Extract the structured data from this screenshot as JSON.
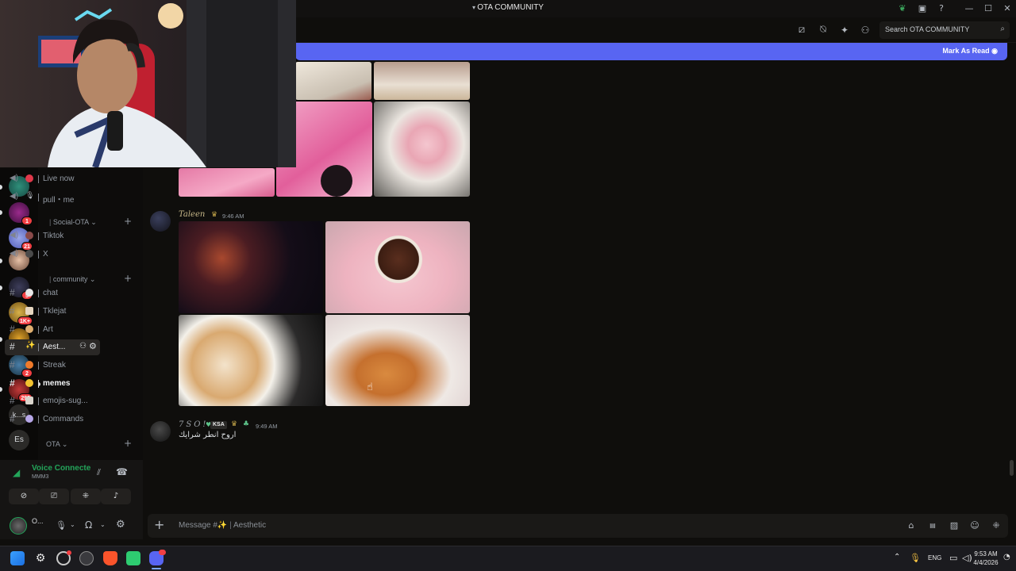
{
  "window": {
    "title": "OTA COMMUNITY"
  },
  "header": {
    "search_placeholder": "Search OTA COMMUNITY"
  },
  "new_messages_bar": {
    "mark_as_read": "Mark As Read"
  },
  "servers": [
    {
      "badge": ""
    },
    {
      "badge": "1"
    },
    {
      "badge": "21"
    },
    {
      "badge": ""
    },
    {
      "badge": "5"
    },
    {
      "badge": "1K+"
    },
    {
      "badge": "49"
    },
    {
      "badge": "2"
    },
    {
      "badge": "293"
    },
    {
      "label": "k...s"
    },
    {
      "label": "Es"
    }
  ],
  "channels": {
    "voice_top": [
      {
        "label": "Live now"
      },
      {
        "label": "pull・me"
      }
    ],
    "category_social": "Social-OTA",
    "social": [
      {
        "label": "Tiktok"
      },
      {
        "label": "X"
      }
    ],
    "category_community": "community",
    "community": [
      {
        "label": "chat"
      },
      {
        "label": "Tklejat"
      },
      {
        "label": "Art"
      },
      {
        "label": "Aest..."
      },
      {
        "label": "Streak"
      },
      {
        "label": "memes"
      },
      {
        "label": "emojis-sug..."
      },
      {
        "label": "Commands"
      }
    ],
    "category_ota": "OTA"
  },
  "voice": {
    "status": "Voice Connecte",
    "channel": "MMM3"
  },
  "user": {
    "name": "O..."
  },
  "messages": [
    {
      "author": "Taleen",
      "time": "9:46 AM"
    },
    {
      "author": "7SO!",
      "tag": "KSA",
      "time": "9:49 AM",
      "text": "اروح انطر شرايك"
    }
  ],
  "composer": {
    "placeholder_prefix": "Message #",
    "placeholder_channel": "Aesthetic"
  },
  "taskbar": {
    "lang": "ENG",
    "time": "9:53 AM",
    "date": "4/4/2026"
  },
  "colors": {
    "accent": "#5865f2",
    "voice_green": "#23a55a",
    "badge_red": "#f23f43",
    "username_gold": "#c8b98a"
  }
}
